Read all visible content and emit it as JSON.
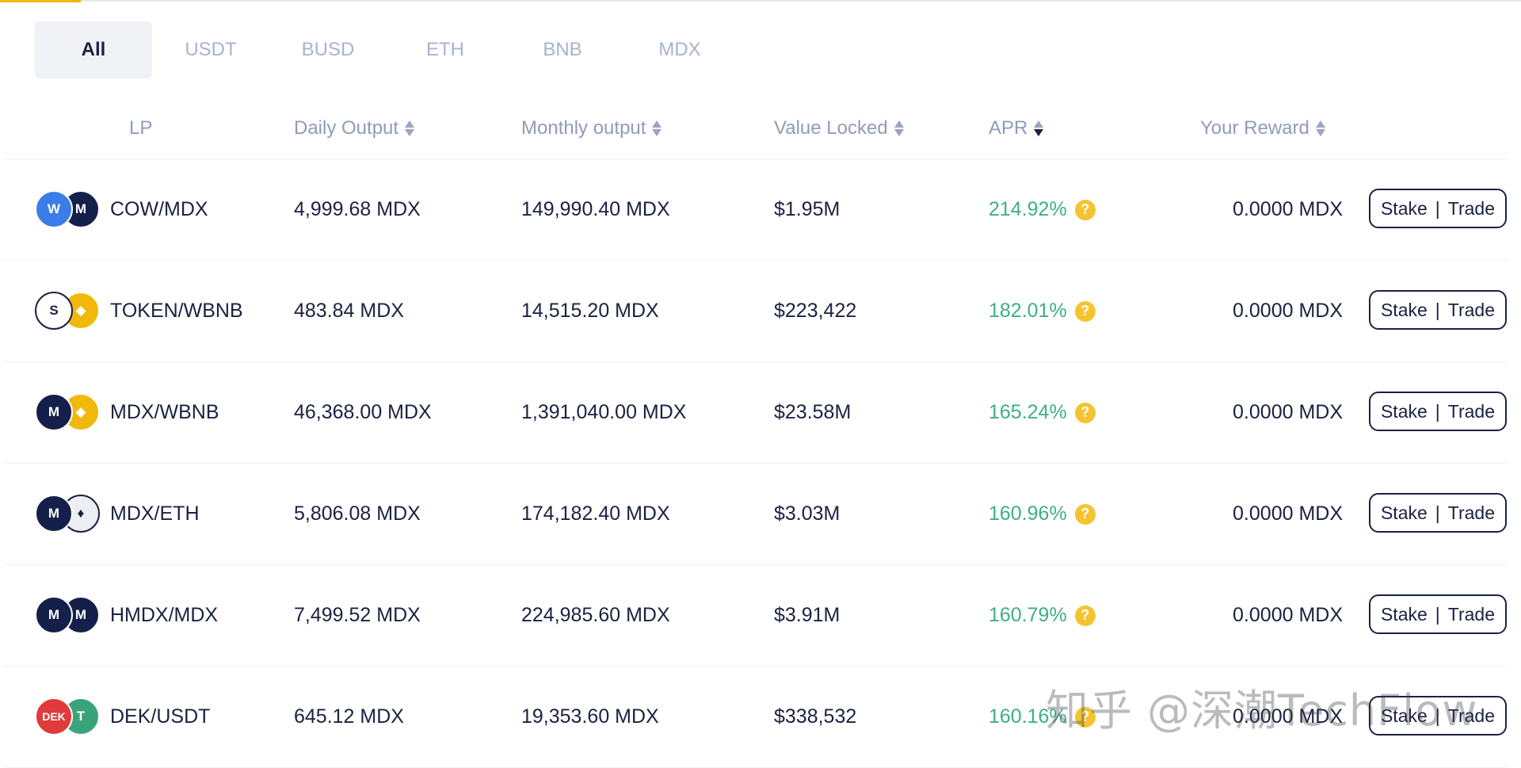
{
  "tabs": [
    "All",
    "USDT",
    "BUSD",
    "ETH",
    "BNB",
    "MDX"
  ],
  "active_tab": "All",
  "columns": {
    "lp": "LP",
    "daily": "Daily Output",
    "monthly": "Monthly output",
    "tvl": "Value Locked",
    "apr": "APR",
    "reward": "Your Reward"
  },
  "actions": {
    "stake": "Stake",
    "separator": "|",
    "trade": "Trade"
  },
  "help_glyph": "?",
  "rows": [
    {
      "pair": "COW/MDX",
      "daily": "4,999.68 MDX",
      "monthly": "149,990.40 MDX",
      "tvl": "$1.95M",
      "apr": "214.92%",
      "reward": "0.0000 MDX",
      "coin_a": {
        "glyph": "W",
        "color": "#3b7de8"
      },
      "coin_b": {
        "glyph": "M",
        "color": "#15204a"
      }
    },
    {
      "pair": "TOKEN/WBNB",
      "daily": "483.84 MDX",
      "monthly": "14,515.20 MDX",
      "tvl": "$223,422",
      "apr": "182.01%",
      "reward": "0.0000 MDX",
      "coin_a": {
        "glyph": "S",
        "color": "#ffffff"
      },
      "coin_b": {
        "glyph": "◆",
        "color": "#f0b90b"
      }
    },
    {
      "pair": "MDX/WBNB",
      "daily": "46,368.00 MDX",
      "monthly": "1,391,040.00 MDX",
      "tvl": "$23.58M",
      "apr": "165.24%",
      "reward": "0.0000 MDX",
      "coin_a": {
        "glyph": "M",
        "color": "#15204a"
      },
      "coin_b": {
        "glyph": "◆",
        "color": "#f0b90b"
      }
    },
    {
      "pair": "MDX/ETH",
      "daily": "5,806.08 MDX",
      "monthly": "174,182.40 MDX",
      "tvl": "$3.03M",
      "apr": "160.96%",
      "reward": "0.0000 MDX",
      "coin_a": {
        "glyph": "M",
        "color": "#15204a"
      },
      "coin_b": {
        "glyph": "♦",
        "color": "#eceef2"
      }
    },
    {
      "pair": "HMDX/MDX",
      "daily": "7,499.52 MDX",
      "monthly": "224,985.60 MDX",
      "tvl": "$3.91M",
      "apr": "160.79%",
      "reward": "0.0000 MDX",
      "coin_a": {
        "glyph": "M",
        "color": "#15204a"
      },
      "coin_b": {
        "glyph": "M",
        "color": "#15204a"
      }
    },
    {
      "pair": "DEK/USDT",
      "daily": "645.12 MDX",
      "monthly": "19,353.60 MDX",
      "tvl": "$338,532",
      "apr": "160.16%",
      "reward": "0.0000 MDX",
      "coin_a": {
        "glyph": "DEK",
        "color": "#e03a3a"
      },
      "coin_b": {
        "glyph": "T",
        "color": "#3aa37a"
      }
    }
  ],
  "watermark": "知乎 @深潮TechFlow"
}
